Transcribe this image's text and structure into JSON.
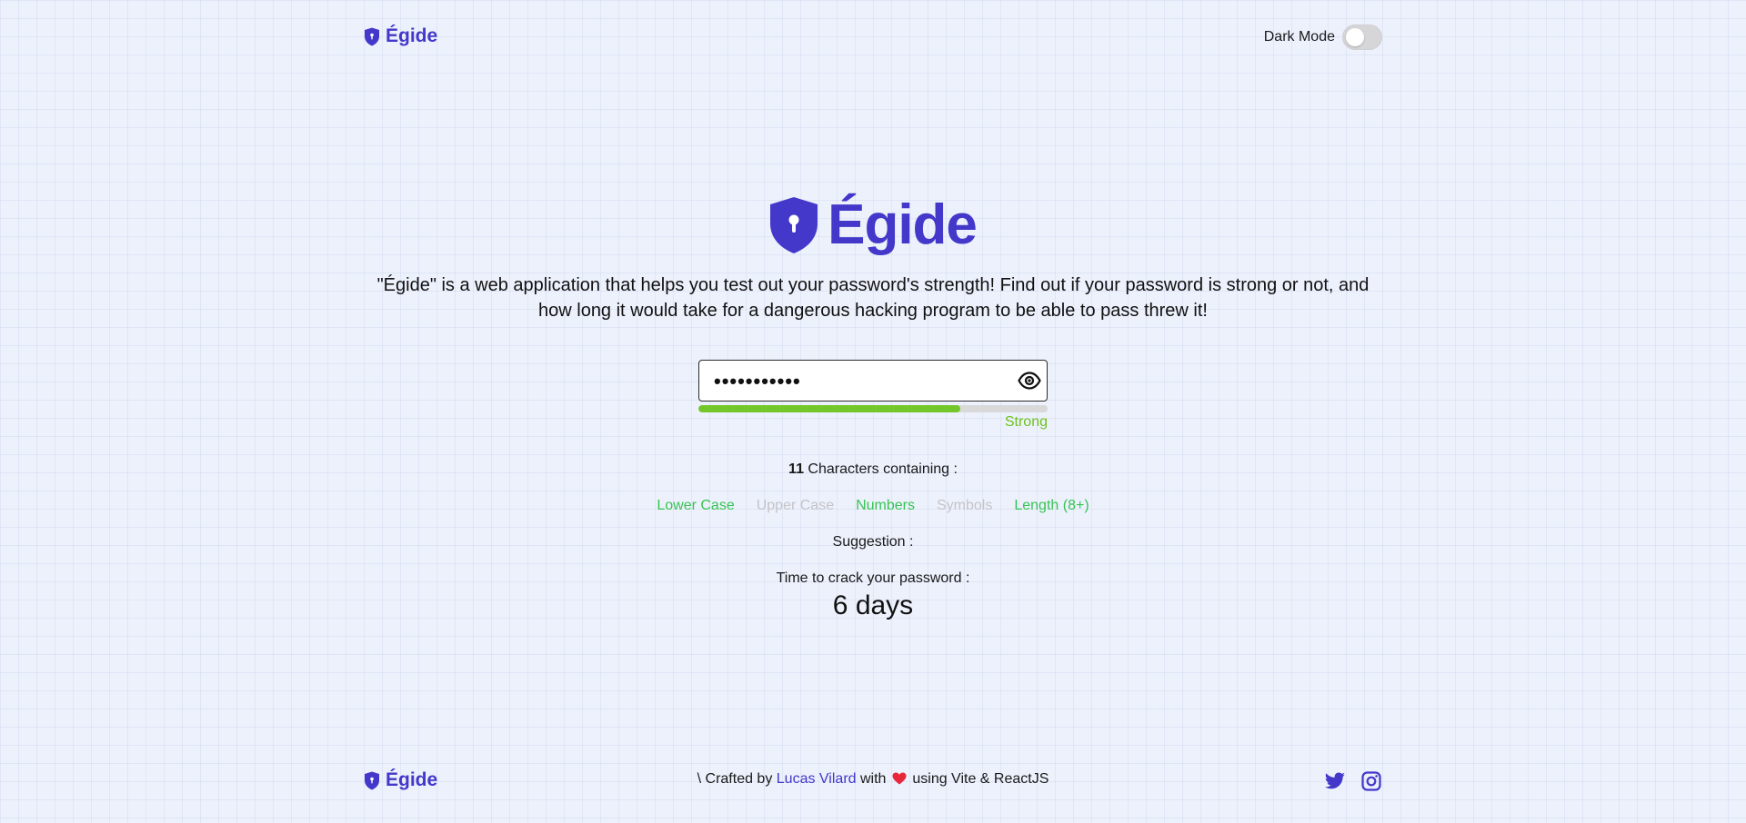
{
  "header": {
    "brand": "Égide",
    "dark_mode_label": "Dark Mode",
    "dark_mode_on": false
  },
  "hero": {
    "title": "Égide",
    "description": "\"Égide\" is a web application that helps you test out your password's strength! Find out if your password is strong or not, and how long it would take for a dangerous hacking program to be able to pass threw it!"
  },
  "password": {
    "masked_value": "•••••••••••",
    "strength_label": "Strong",
    "strength_fraction": 0.75,
    "strength_color": "#74c72a"
  },
  "analysis": {
    "char_count": "11",
    "char_text": "Characters containing :",
    "criteria": [
      {
        "label": "Lower Case",
        "met": true
      },
      {
        "label": "Upper Case",
        "met": false
      },
      {
        "label": "Numbers",
        "met": true
      },
      {
        "label": "Symbols",
        "met": false
      },
      {
        "label": "Length (8+)",
        "met": true
      }
    ],
    "suggestion_label": "Suggestion :",
    "crack_label": "Time to crack your password :",
    "crack_value": "6 days"
  },
  "footer": {
    "brand": "Égide",
    "credit_prefix": "\\ Crafted by",
    "credit_author": "Lucas Vilard",
    "credit_with": "with",
    "credit_suffix": "using Vite & ReactJS",
    "social_icons": [
      "twitter-icon",
      "instagram-icon"
    ]
  },
  "colors": {
    "brand": "#4338ca",
    "met": "#37c454",
    "unmet": "#c4c4c8",
    "strong": "#6ec21e"
  }
}
